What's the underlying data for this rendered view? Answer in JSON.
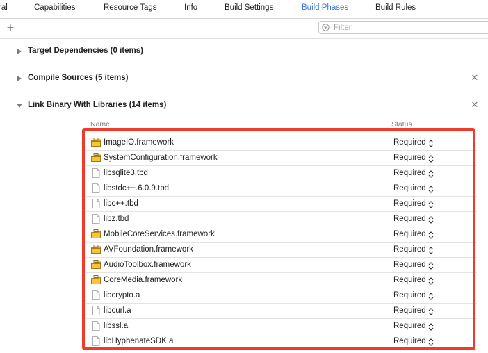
{
  "tabs": [
    {
      "label": "ral",
      "active": false
    },
    {
      "label": "Capabilities",
      "active": false
    },
    {
      "label": "Resource Tags",
      "active": false
    },
    {
      "label": "Info",
      "active": false
    },
    {
      "label": "Build Settings",
      "active": false
    },
    {
      "label": "Build Phases",
      "active": true
    },
    {
      "label": "Build Rules",
      "active": false
    }
  ],
  "toolbar": {
    "add_label": "+",
    "filter_placeholder": "Filter"
  },
  "phases": [
    {
      "title": "Target Dependencies (0 items)",
      "expanded": false,
      "removable": false
    },
    {
      "title": "Compile Sources (5 items)",
      "expanded": false,
      "removable": true
    },
    {
      "title": "Link Binary With Libraries (14 items)",
      "expanded": true,
      "removable": true
    }
  ],
  "library_table": {
    "columns": {
      "name": "Name",
      "status": "Status"
    },
    "rows": [
      {
        "name": "ImageIO.framework",
        "status": "Required",
        "kind": "framework-icon"
      },
      {
        "name": "SystemConfiguration.framework",
        "status": "Required",
        "kind": "framework-icon"
      },
      {
        "name": "libsqlite3.tbd",
        "status": "Required",
        "kind": "file-icon"
      },
      {
        "name": "libstdc++.6.0.9.tbd",
        "status": "Required",
        "kind": "file-icon"
      },
      {
        "name": "libc++.tbd",
        "status": "Required",
        "kind": "file-icon"
      },
      {
        "name": "libz.tbd",
        "status": "Required",
        "kind": "file-icon"
      },
      {
        "name": "MobileCoreServices.framework",
        "status": "Required",
        "kind": "framework-icon"
      },
      {
        "name": "AVFoundation.framework",
        "status": "Required",
        "kind": "framework-icon"
      },
      {
        "name": "AudioToolbox.framework",
        "status": "Required",
        "kind": "framework-icon"
      },
      {
        "name": "CoreMedia.framework",
        "status": "Required",
        "kind": "framework-icon"
      },
      {
        "name": "libcrypto.a",
        "status": "Required",
        "kind": "file-icon"
      },
      {
        "name": "libcurl.a",
        "status": "Required",
        "kind": "file-icon"
      },
      {
        "name": "libssl.a",
        "status": "Required",
        "kind": "file-icon"
      },
      {
        "name": "libHyphenateSDK.a",
        "status": "Required",
        "kind": "file-icon"
      }
    ]
  },
  "colors": {
    "accent": "#3b7cd7",
    "highlight": "#ef3a2c",
    "framework_icon": "#e8b21f"
  }
}
